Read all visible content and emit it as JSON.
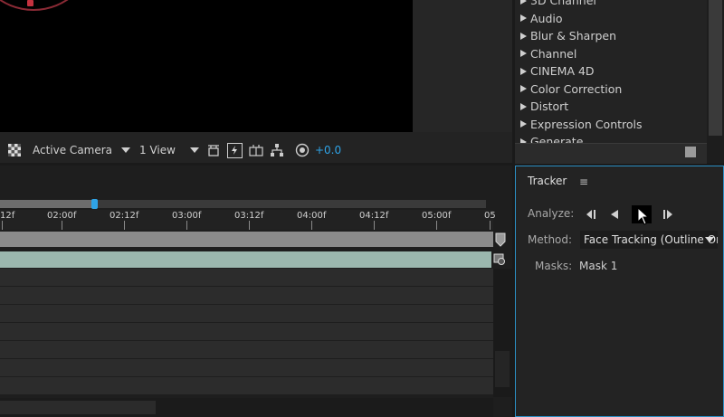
{
  "viewer_toolbar": {
    "camera_label": "Active Camera",
    "view_label": "1 View",
    "exposure_value": "+0.0"
  },
  "effects_panel": {
    "categories": [
      "3D Channel",
      "Audio",
      "Blur & Sharpen",
      "Channel",
      "CINEMA 4D",
      "Color Correction",
      "Distort",
      "Expression Controls",
      "Generate"
    ]
  },
  "timeline": {
    "ruler_labels": [
      "12f",
      "02:00f",
      "02:12f",
      "03:00f",
      "03:12f",
      "04:00f",
      "04:12f",
      "05:00f",
      "05"
    ]
  },
  "tracker": {
    "title": "Tracker",
    "menu_icon": "≡",
    "analyze_label": "Analyze:",
    "method_label": "Method:",
    "method_value": "Face Tracking (Outline Only)",
    "masks_label": "Masks:",
    "masks_value": "Mask 1"
  },
  "colors": {
    "accent": "#2fa3e6",
    "layer_bar": "#9bb7ae",
    "panel_border": "#2b8fc4"
  }
}
